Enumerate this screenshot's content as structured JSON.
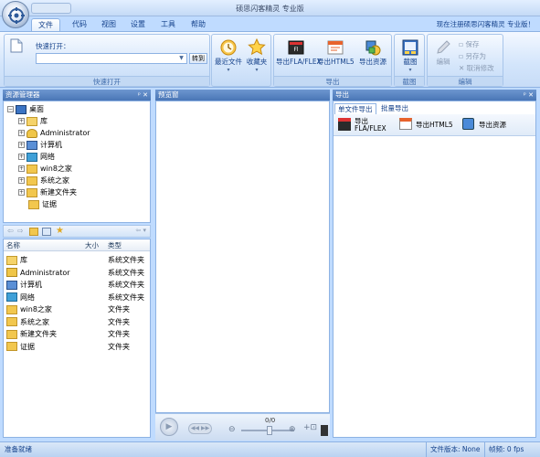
{
  "window": {
    "title": "硕思闪客精灵 专业版"
  },
  "ribbon": {
    "tabs": [
      "文件",
      "代码",
      "视图",
      "设置",
      "工具",
      "帮助"
    ],
    "register_link": "现在注册硕思闪客精灵 专业版！",
    "quick_open": {
      "label": "快速打开：",
      "go_button": "转到",
      "group_label": "快速打开"
    },
    "recent_files": "最近文件",
    "favorites": "收藏夹",
    "export_group": {
      "label": "导出",
      "buttons": [
        "导出FLA/FLEX",
        "导出HTML5",
        "导出资源"
      ]
    },
    "screenshot_group": {
      "label": "截图",
      "button": "截图"
    },
    "edit_group": {
      "label": "编辑",
      "edit": "编辑",
      "save": "保存",
      "save_as": "另存为",
      "cancel": "取消修改"
    }
  },
  "resource_manager": {
    "title": "资源管理器",
    "tree": [
      {
        "label": "桌面",
        "level": 0,
        "icon": "desktop-icon",
        "expander": "-"
      },
      {
        "label": "库",
        "level": 1,
        "icon": "library-icon",
        "expander": "+"
      },
      {
        "label": "Administrator",
        "level": 1,
        "icon": "user-icon",
        "expander": "+"
      },
      {
        "label": "计算机",
        "level": 1,
        "icon": "computer-icon",
        "expander": "+"
      },
      {
        "label": "网络",
        "level": 1,
        "icon": "network-icon",
        "expander": "+"
      },
      {
        "label": "win8之家",
        "level": 1,
        "icon": "folder-icon",
        "expander": "+"
      },
      {
        "label": "系统之家",
        "level": 1,
        "icon": "folder-icon",
        "expander": "+"
      },
      {
        "label": "新建文件夹",
        "level": 1,
        "icon": "folder-icon",
        "expander": "+"
      },
      {
        "label": "证据",
        "level": 1,
        "icon": "folder-icon",
        "expander": ""
      }
    ],
    "list_columns": [
      "名称",
      "大小",
      "类型"
    ],
    "list_rows": [
      {
        "name": "库",
        "size": "",
        "type": "系统文件夹",
        "icon": "library-icon"
      },
      {
        "name": "Administrator",
        "size": "",
        "type": "系统文件夹",
        "icon": "user-icon"
      },
      {
        "name": "计算机",
        "size": "",
        "type": "系统文件夹",
        "icon": "computer-icon"
      },
      {
        "name": "网络",
        "size": "",
        "type": "系统文件夹",
        "icon": "network-icon"
      },
      {
        "name": "win8之家",
        "size": "",
        "type": "文件夹",
        "icon": "folder-icon"
      },
      {
        "name": "系统之家",
        "size": "",
        "type": "文件夹",
        "icon": "folder-icon"
      },
      {
        "name": "新建文件夹",
        "size": "",
        "type": "文件夹",
        "icon": "folder-icon"
      },
      {
        "name": "证据",
        "size": "",
        "type": "文件夹",
        "icon": "folder-icon"
      }
    ]
  },
  "preview": {
    "title": "预览窗",
    "frame_counter": "0/0"
  },
  "export_panel": {
    "title": "导出",
    "tabs": [
      "单文件导出",
      "批量导出"
    ],
    "buttons": [
      {
        "label_line1": "导出",
        "label_line2": "FLA/FLEX"
      },
      {
        "label_line1": "导出HTML5",
        "label_line2": ""
      },
      {
        "label_line1": "导出资源",
        "label_line2": ""
      }
    ]
  },
  "status": {
    "left": "准备就绪",
    "file_version": "文件版本: None",
    "frame_rate": "帧频: 0 fps"
  },
  "colors": {
    "ribbon_blue": "#bfdbff",
    "pane_header": "#4a76b6",
    "accent": "#15428b"
  }
}
